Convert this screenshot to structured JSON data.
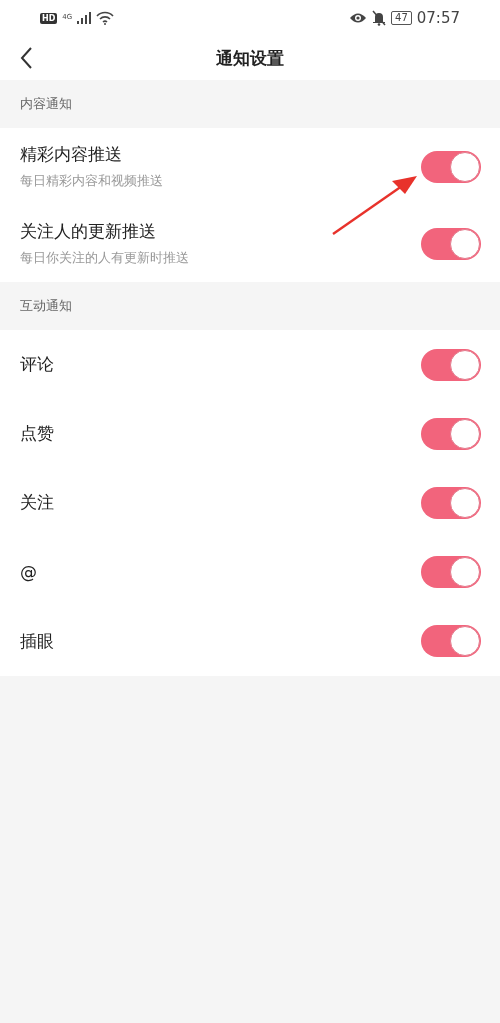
{
  "status_bar": {
    "hd": "HD",
    "network": "4G",
    "battery": "47",
    "time": "07:57"
  },
  "header": {
    "title": "通知设置"
  },
  "sections": [
    {
      "title": "内容通知",
      "items": [
        {
          "label": "精彩内容推送",
          "description": "每日精彩内容和视频推送",
          "on": true
        },
        {
          "label": "关注人的更新推送",
          "description": "每日你关注的人有更新时推送",
          "on": true
        }
      ]
    },
    {
      "title": "互动通知",
      "items": [
        {
          "label": "评论",
          "on": true
        },
        {
          "label": "点赞",
          "on": true
        },
        {
          "label": "关注",
          "on": true
        },
        {
          "label": "@",
          "on": true
        },
        {
          "label": "插眼",
          "on": true
        }
      ]
    }
  ]
}
